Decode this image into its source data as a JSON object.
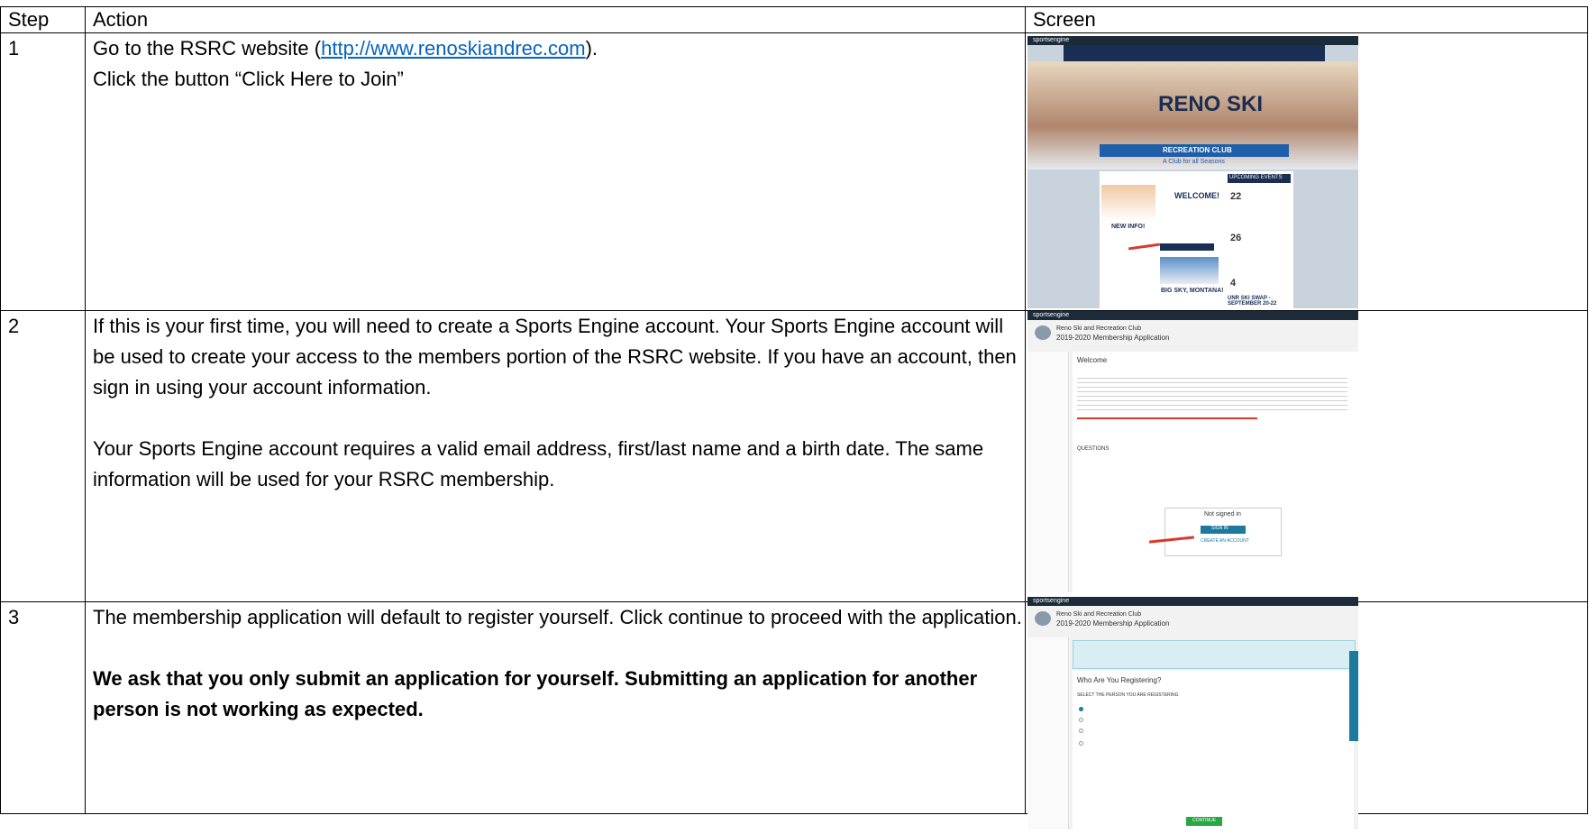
{
  "headers": {
    "step": "Step",
    "action": "Action",
    "screen": "Screen"
  },
  "rows": [
    {
      "step": "1",
      "line1_pre": "Go to the RSRC website (",
      "link": "http://www.renoskiandrec.com",
      "line1_post": ").",
      "line2": "Click the button “Click Here to Join”"
    },
    {
      "step": "2",
      "para1": "If this is your first time, you will need to create a Sports Engine account.  Your Sports Engine account will be used to create your access to the members portion of the RSRC website.  If you have an account, then sign in using your account information.",
      "para2": "Your Sports Engine account requires a valid email address, first/last name and a birth date.  The same information will be used for your RSRC membership."
    },
    {
      "step": "3",
      "para1": "The membership application will default to register yourself.   Click continue to proceed with the application.",
      "para2_bold": "We ask that you only submit an application for yourself.  Submitting an application for another person is not working as expected."
    }
  ],
  "screens": {
    "s1": {
      "brand": "sportsengine",
      "logo": "RENO SKI",
      "club": "RECREATION CLUB",
      "tagline": "A Club for all Seasons",
      "welcome": "WELCOME!",
      "events": "UPCOMING EVENTS",
      "newinfo": "NEW INFO!",
      "bigsky": "BIG SKY, MONTANA!",
      "swap": "UNR SKI SWAP - SEPTEMBER 20-22",
      "d1": "22",
      "d2": "26",
      "d3": "4"
    },
    "s2": {
      "brand": "sportsengine",
      "org": "Reno Ski and Recreation Club",
      "app": "2019-2020 Membership Application",
      "welcome": "Welcome",
      "questions": "QUESTIONS",
      "notsigned": "Not signed in",
      "signin": "SIGN IN",
      "create": "CREATE AN ACCOUNT"
    },
    "s3": {
      "brand": "sportsengine",
      "org": "Reno Ski and Recreation Club",
      "app": "2019-2020 Membership Application",
      "who": "Who Are You Registering?",
      "select": "SELECT THE PERSON YOU ARE REGISTERING",
      "cont": "CONTINUE"
    },
    "colors": {
      "navy": "#1c2b3a",
      "arrow": "#d9392b",
      "link": "#0563c1",
      "green": "#27a844",
      "teal": "#1e7a9c"
    }
  }
}
